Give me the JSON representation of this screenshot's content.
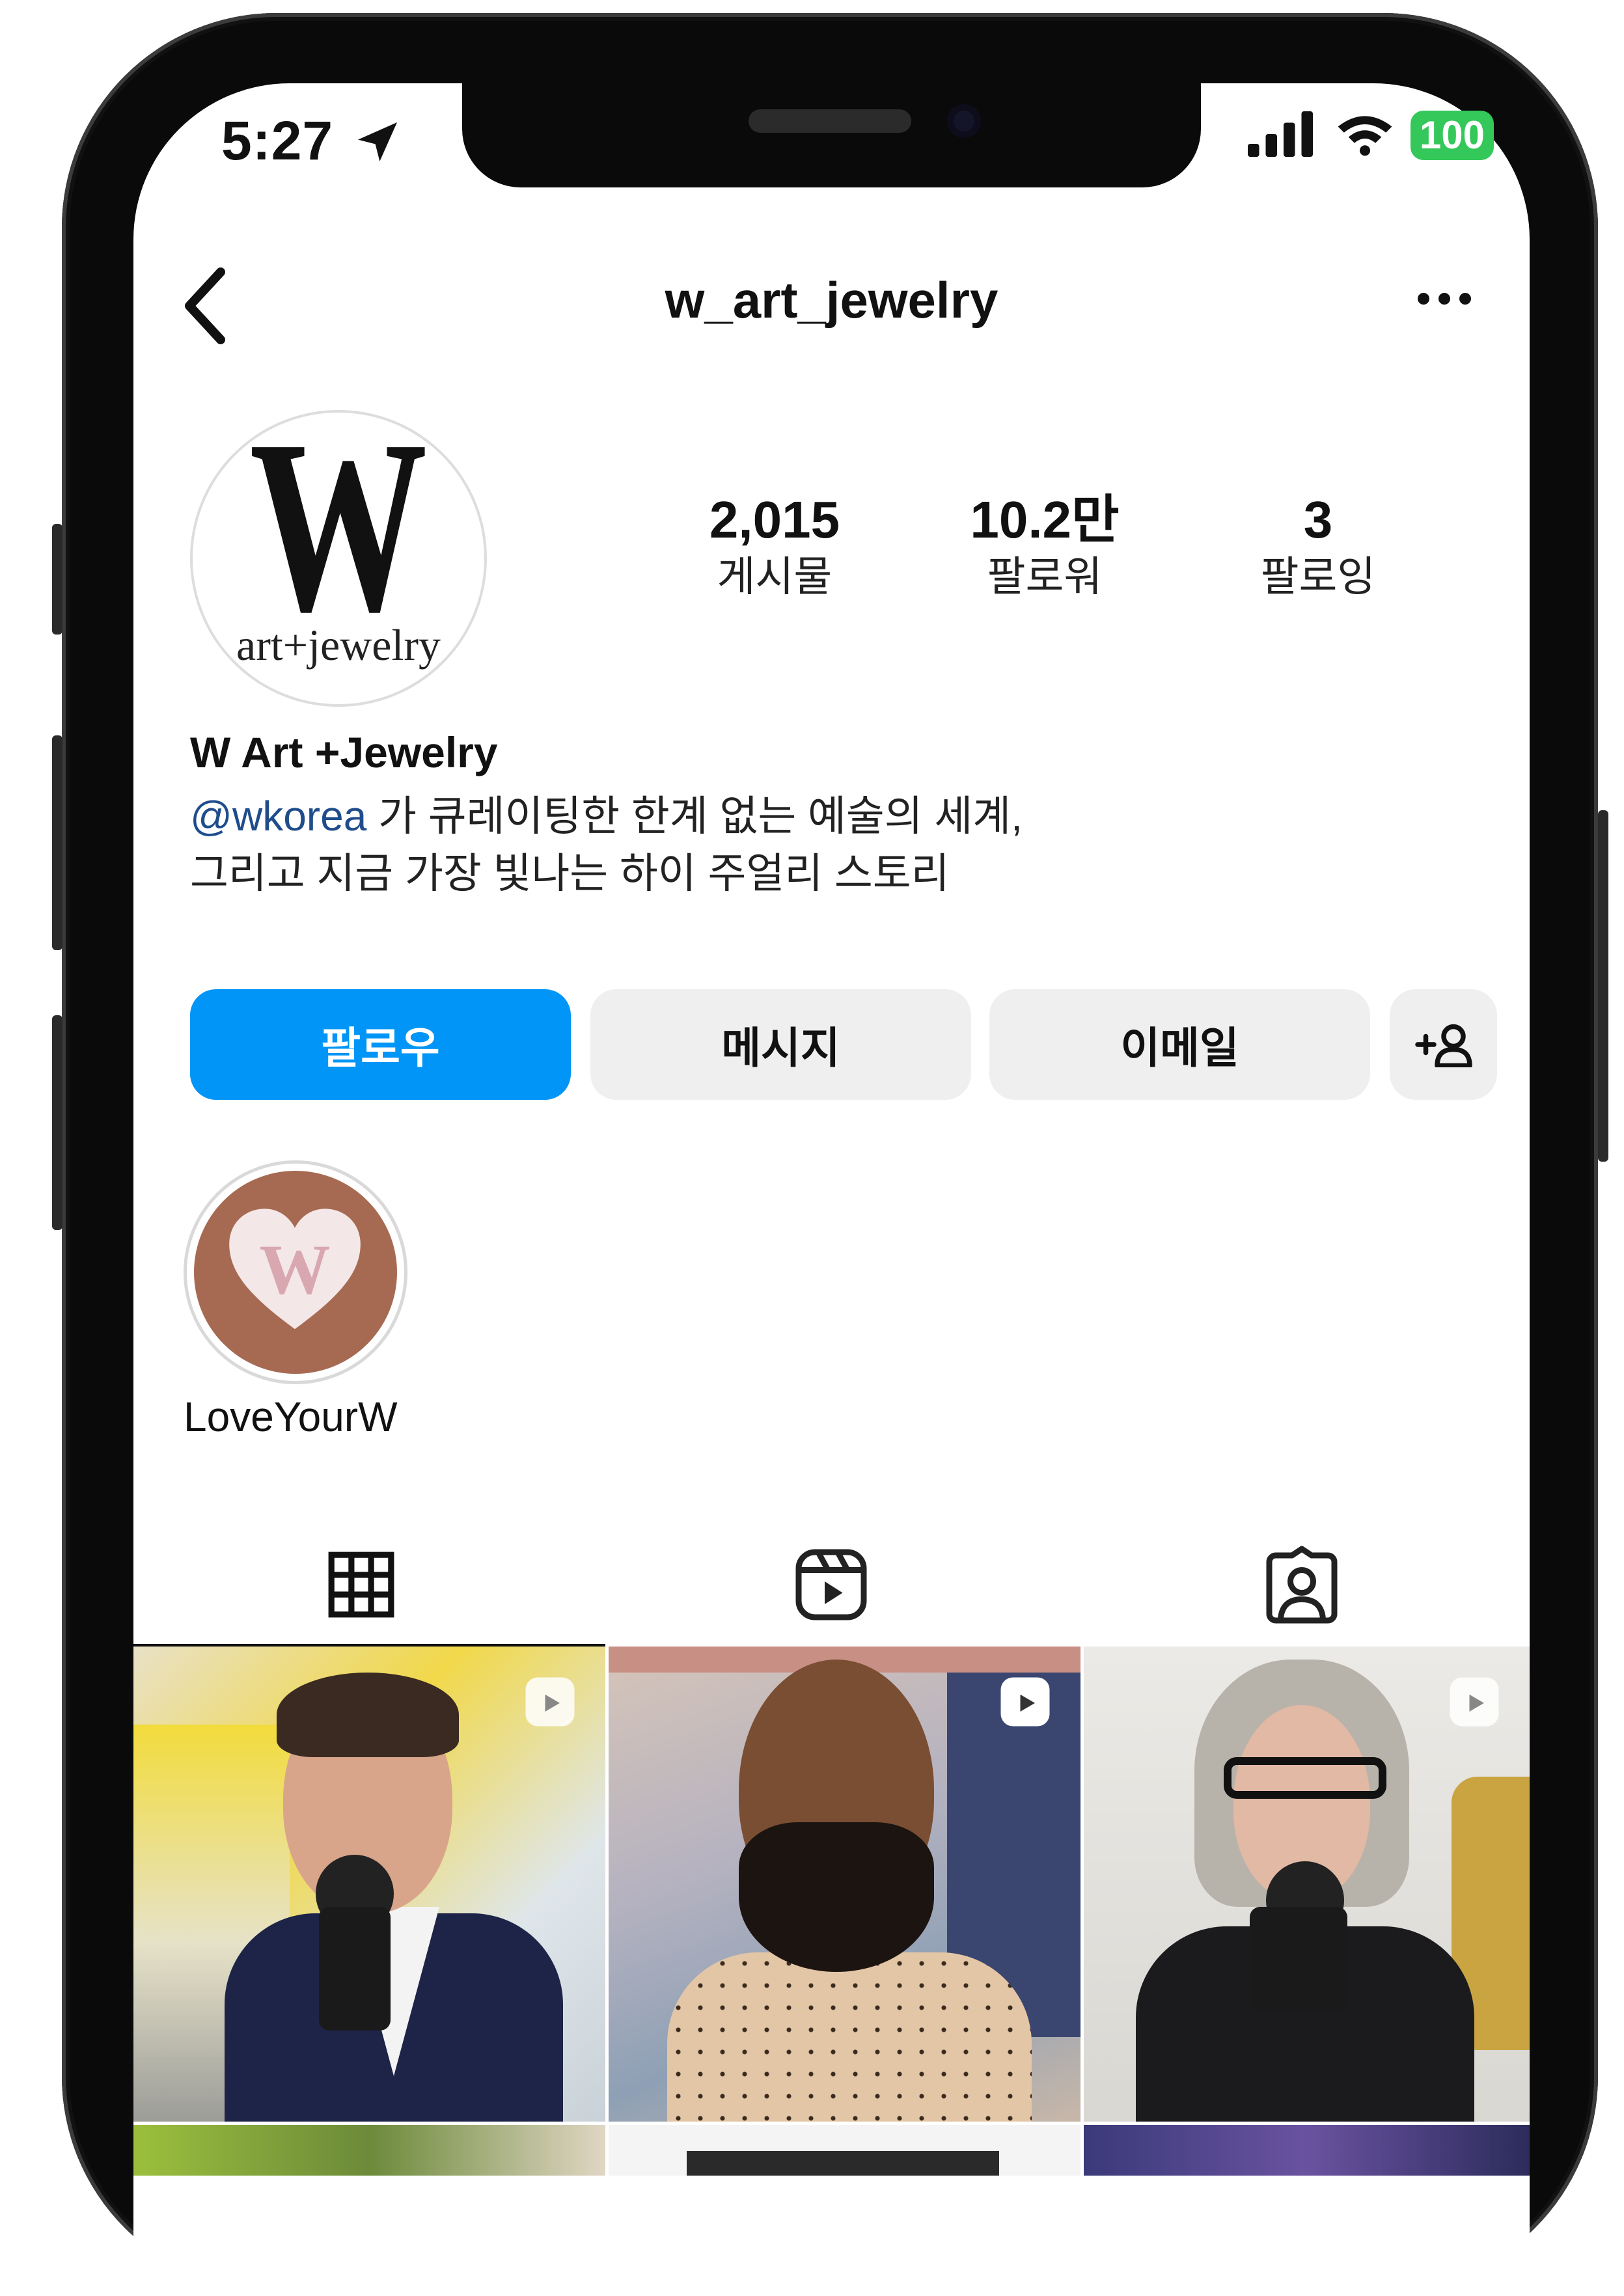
{
  "status_bar": {
    "time": "5:27",
    "battery": "100"
  },
  "header": {
    "username": "w_art_jewelry"
  },
  "profile": {
    "avatar_logo": "W",
    "avatar_subtext": "art+jewelry",
    "display_name": "W Art +Jewelry",
    "bio_mention": "@wkorea",
    "bio_line1": " 가 큐레이팅한 한계 없는 예술의 세계,",
    "bio_line2": "그리고 지금 가장 빛나는 하이 주얼리 스토리"
  },
  "stats": [
    {
      "value": "2,015",
      "label": "게시물"
    },
    {
      "value": "10.2만",
      "label": "팔로워"
    },
    {
      "value": "3",
      "label": "팔로잉"
    }
  ],
  "actions": {
    "follow": "팔로우",
    "message": "메시지",
    "email": "이메일",
    "suggest": "+♕"
  },
  "highlights": [
    {
      "label": "LoveYourW"
    }
  ],
  "tabs": [
    {
      "icon": "grid-icon",
      "active": true
    },
    {
      "icon": "reels-icon",
      "active": false
    },
    {
      "icon": "tagged-icon",
      "active": false
    }
  ],
  "colors": {
    "accent": "#0095f6",
    "mention": "#1f4d8c",
    "battery": "#34c759",
    "button_bg": "#efefef"
  }
}
